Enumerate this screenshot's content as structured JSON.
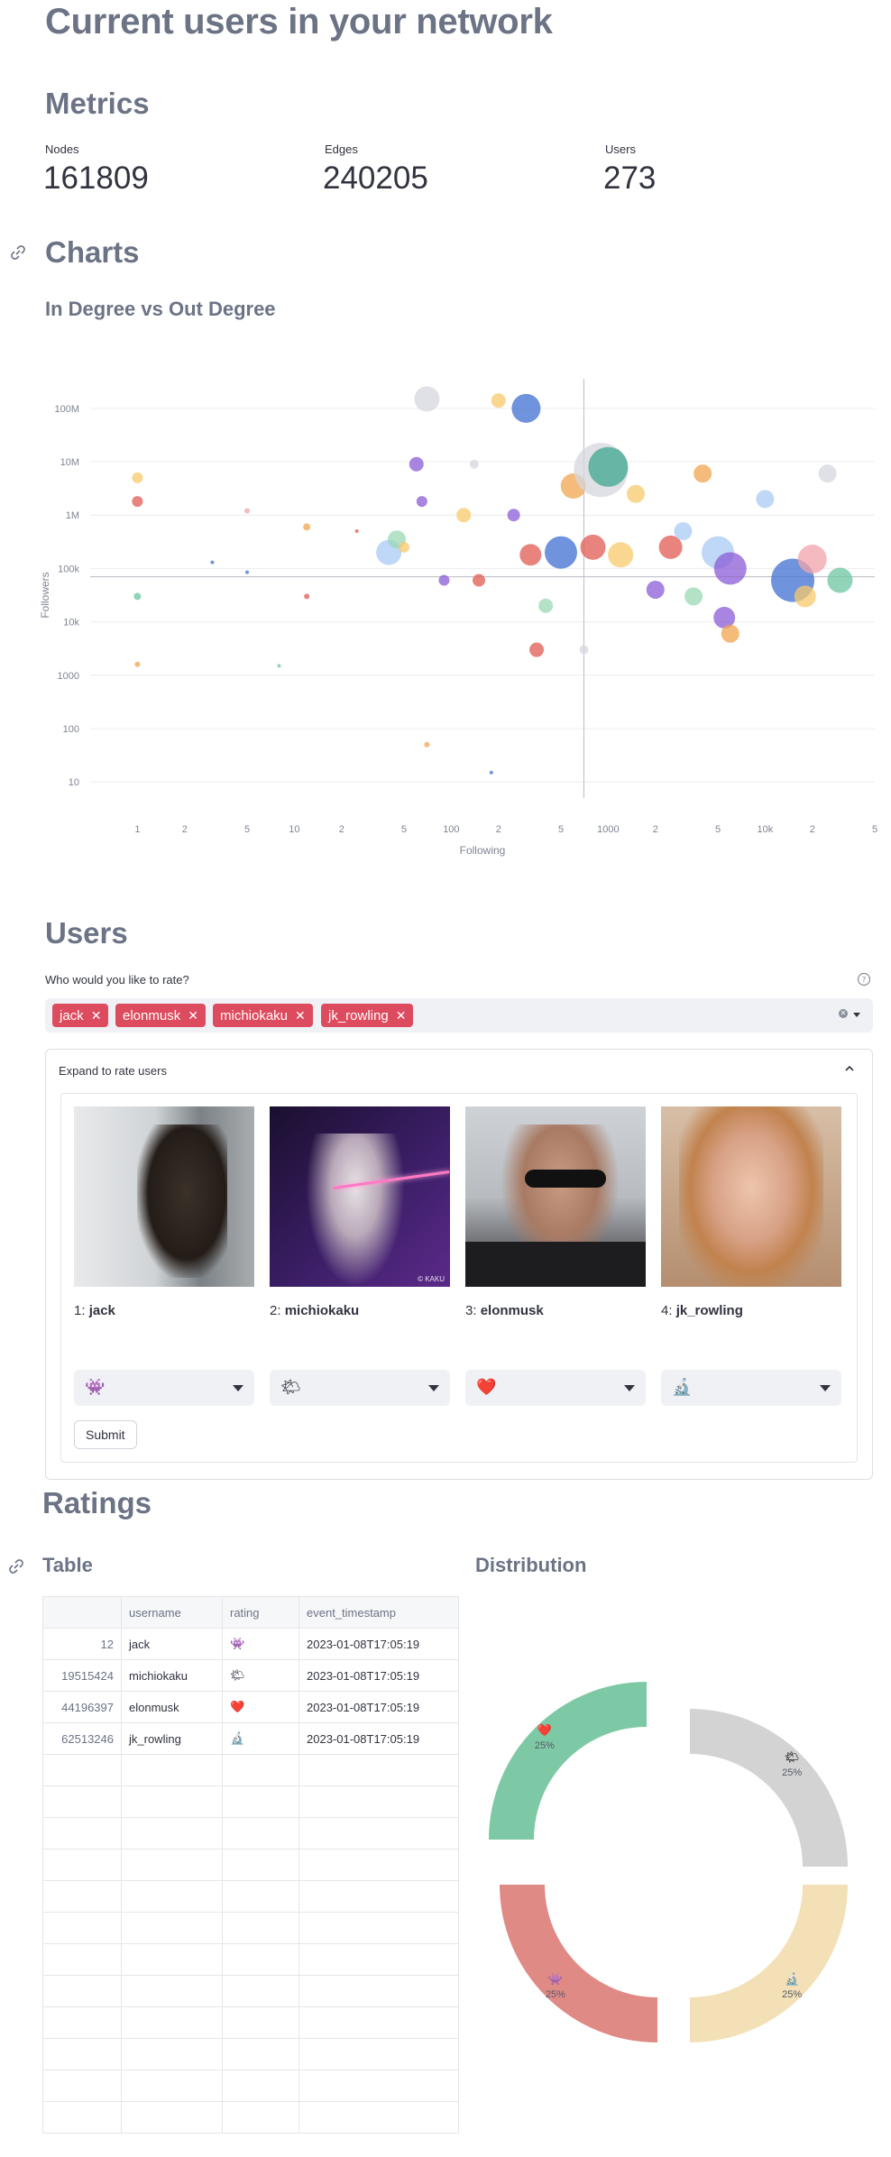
{
  "page": {
    "title": "Current users in your network"
  },
  "metrics": {
    "heading": "Metrics",
    "items": [
      {
        "label": "Nodes",
        "value": "161809"
      },
      {
        "label": "Edges",
        "value": "240205"
      },
      {
        "label": "Users",
        "value": "273"
      }
    ]
  },
  "charts": {
    "heading": "Charts",
    "subheading": "In Degree vs Out Degree"
  },
  "chart_data": {
    "type": "scatter",
    "title": "In Degree vs Out Degree",
    "xlabel": "Following",
    "ylabel": "Followers",
    "xscale": "log",
    "yscale": "log",
    "xlim": [
      0.5,
      50000
    ],
    "ylim": [
      5,
      200000000
    ],
    "x_ticks": [
      "1",
      "2",
      "5",
      "10",
      "2",
      "5",
      "100",
      "2",
      "5",
      "1000",
      "2",
      "5",
      "10k",
      "2",
      "5"
    ],
    "y_ticks": [
      "10",
      "100",
      "1000",
      "10k",
      "100k",
      "1M",
      "10M",
      "100M"
    ],
    "reference_lines": {
      "x": 700,
      "y": 70000
    },
    "grid": true,
    "points": [
      {
        "x": 1,
        "y": 5000000,
        "size": 6,
        "color": "#f7c96b"
      },
      {
        "x": 1,
        "y": 1800000,
        "size": 6,
        "color": "#e05a52"
      },
      {
        "x": 1,
        "y": 30000,
        "size": 4,
        "color": "#6cc5a0"
      },
      {
        "x": 1,
        "y": 1600,
        "size": 3,
        "color": "#f0a44d"
      },
      {
        "x": 3,
        "y": 130000,
        "size": 2,
        "color": "#3f6fd0"
      },
      {
        "x": 5,
        "y": 85000,
        "size": 2,
        "color": "#3f6fd0"
      },
      {
        "x": 5,
        "y": 1200000,
        "size": 3,
        "color": "#f2a3aa"
      },
      {
        "x": 8,
        "y": 1500,
        "size": 2,
        "color": "#6cc5a0"
      },
      {
        "x": 12,
        "y": 600000,
        "size": 4,
        "color": "#f0a44d"
      },
      {
        "x": 12,
        "y": 30000,
        "size": 3,
        "color": "#e05a52"
      },
      {
        "x": 25,
        "y": 500000,
        "size": 2,
        "color": "#e05a52"
      },
      {
        "x": 40,
        "y": 200000,
        "size": 14,
        "color": "#a9cbf5"
      },
      {
        "x": 45,
        "y": 350000,
        "size": 10,
        "color": "#9ad8b4"
      },
      {
        "x": 50,
        "y": 250000,
        "size": 6,
        "color": "#f7c96b"
      },
      {
        "x": 60,
        "y": 9000000,
        "size": 8,
        "color": "#8a5cd6"
      },
      {
        "x": 65,
        "y": 1800000,
        "size": 6,
        "color": "#8a5cd6"
      },
      {
        "x": 70,
        "y": 50,
        "size": 3,
        "color": "#f0a44d"
      },
      {
        "x": 70,
        "y": 150000000,
        "size": 14,
        "color": "#d5d7de"
      },
      {
        "x": 90,
        "y": 60000,
        "size": 6,
        "color": "#8a5cd6"
      },
      {
        "x": 120,
        "y": 1000000,
        "size": 8,
        "color": "#f7c96b"
      },
      {
        "x": 140,
        "y": 9000000,
        "size": 5,
        "color": "#d5d7de"
      },
      {
        "x": 150,
        "y": 60000,
        "size": 7,
        "color": "#e05a52"
      },
      {
        "x": 180,
        "y": 15,
        "size": 2,
        "color": "#3f6fd0"
      },
      {
        "x": 200,
        "y": 140000000,
        "size": 8,
        "color": "#f7c96b"
      },
      {
        "x": 300,
        "y": 100000000,
        "size": 16,
        "color": "#3f6fd0"
      },
      {
        "x": 250,
        "y": 1000000,
        "size": 7,
        "color": "#8a5cd6"
      },
      {
        "x": 320,
        "y": 180000,
        "size": 12,
        "color": "#e05a52"
      },
      {
        "x": 350,
        "y": 3000,
        "size": 8,
        "color": "#e05a52"
      },
      {
        "x": 400,
        "y": 20000,
        "size": 8,
        "color": "#9ad8b4"
      },
      {
        "x": 500,
        "y": 200000,
        "size": 18,
        "color": "#3f6fd0"
      },
      {
        "x": 600,
        "y": 3500000,
        "size": 14,
        "color": "#f0a44d"
      },
      {
        "x": 700,
        "y": 3000,
        "size": 5,
        "color": "#d5d7de"
      },
      {
        "x": 800,
        "y": 250000,
        "size": 14,
        "color": "#e05a52"
      },
      {
        "x": 900,
        "y": 7000000,
        "size": 30,
        "color": "#d5d7de"
      },
      {
        "x": 1000,
        "y": 8000000,
        "size": 22,
        "color": "#3fa58e"
      },
      {
        "x": 1200,
        "y": 180000,
        "size": 14,
        "color": "#f7c96b"
      },
      {
        "x": 1500,
        "y": 2500000,
        "size": 10,
        "color": "#f7c96b"
      },
      {
        "x": 2000,
        "y": 40000,
        "size": 10,
        "color": "#8a5cd6"
      },
      {
        "x": 2500,
        "y": 250000,
        "size": 13,
        "color": "#e05a52"
      },
      {
        "x": 3000,
        "y": 500000,
        "size": 10,
        "color": "#a9cbf5"
      },
      {
        "x": 3500,
        "y": 30000,
        "size": 10,
        "color": "#9ad8b4"
      },
      {
        "x": 4000,
        "y": 6000000,
        "size": 10,
        "color": "#f0a44d"
      },
      {
        "x": 5000,
        "y": 200000,
        "size": 18,
        "color": "#a9cbf5"
      },
      {
        "x": 6000,
        "y": 100000,
        "size": 18,
        "color": "#8a5cd6"
      },
      {
        "x": 5500,
        "y": 12000,
        "size": 12,
        "color": "#8a5cd6"
      },
      {
        "x": 6000,
        "y": 6000,
        "size": 10,
        "color": "#f0a44d"
      },
      {
        "x": 10000,
        "y": 2000000,
        "size": 10,
        "color": "#a9cbf5"
      },
      {
        "x": 15000,
        "y": 60000,
        "size": 24,
        "color": "#3f6fd0"
      },
      {
        "x": 20000,
        "y": 150000,
        "size": 16,
        "color": "#f2a3aa"
      },
      {
        "x": 18000,
        "y": 30000,
        "size": 12,
        "color": "#f7c96b"
      },
      {
        "x": 25000,
        "y": 6000000,
        "size": 10,
        "color": "#d5d7de"
      },
      {
        "x": 30000,
        "y": 60000,
        "size": 14,
        "color": "#6cc5a0"
      }
    ]
  },
  "users": {
    "heading": "Users",
    "select_label": "Who would you like to rate?",
    "help_icon": "question-circle-icon",
    "selected": [
      "jack",
      "elonmusk",
      "michiokaku",
      "jk_rowling"
    ],
    "expander_label": "Expand to rate users",
    "cards": [
      {
        "index": "1: ",
        "name": "jack",
        "rating": "👾"
      },
      {
        "index": "2: ",
        "name": "michiokaku",
        "rating": "🌤"
      },
      {
        "index": "3: ",
        "name": "elonmusk",
        "rating": "❤️"
      },
      {
        "index": "4: ",
        "name": "jk_rowling",
        "rating": "🔬"
      }
    ],
    "image_watermark": "© KAKU",
    "submit_label": "Submit"
  },
  "ratings": {
    "heading": "Ratings",
    "table_heading": "Table",
    "distribution_heading": "Distribution",
    "table": {
      "columns": [
        "",
        "username",
        "rating",
        "event_timestamp"
      ],
      "rows": [
        [
          "12",
          "jack",
          "👾",
          "2023-01-08T17:05:19"
        ],
        [
          "19515424",
          "michiokaku",
          "🌤",
          "2023-01-08T17:05:19"
        ],
        [
          "44196397",
          "elonmusk",
          "❤️",
          "2023-01-08T17:05:19"
        ],
        [
          "62513246",
          "jk_rowling",
          "🔬",
          "2023-01-08T17:05:19"
        ]
      ]
    },
    "distribution": {
      "type": "pie",
      "slices": [
        {
          "label": "🌤",
          "value": 25,
          "text": "25%",
          "color": "#d3d3d3"
        },
        {
          "label": "🔬",
          "value": 25,
          "text": "25%",
          "color": "#f3e0b6"
        },
        {
          "label": "👾",
          "value": 25,
          "text": "25%",
          "color": "#e08a86"
        },
        {
          "label": "❤️",
          "value": 25,
          "text": "25%",
          "color": "#7ec9a5"
        }
      ]
    }
  }
}
